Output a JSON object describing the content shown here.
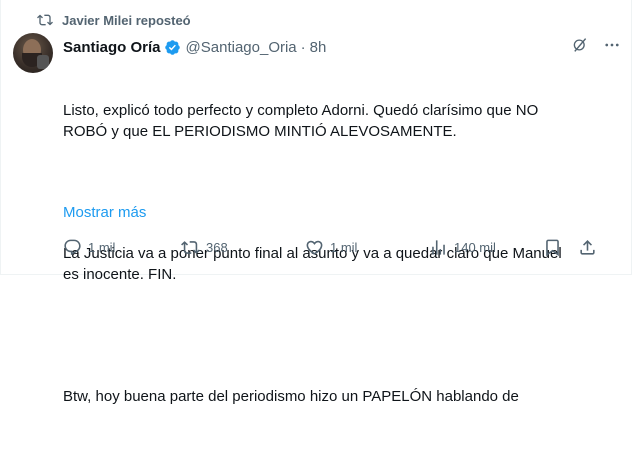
{
  "repost": {
    "text": "Javier Milei reposteó",
    "icon": "repost-icon"
  },
  "author": {
    "name": "Santiago Oría",
    "handle": "@Santiago_Oria",
    "separator": "·",
    "time": "8h",
    "verified": true,
    "verified_color": "#1d9bf0"
  },
  "tweet": {
    "paragraph1": "Listo, explicó todo perfecto y completo Adorni. Quedó clarísimo que NO\nROBÓ y que EL PERIODISMO MINTIÓ ALEVOSAMENTE.",
    "paragraph2": "La Justicia va a poner punto final al asunto y va a quedar claro que Manuel\nes inocente. FIN.",
    "paragraph3": "Btw, hoy buena parte del periodismo hizo un PAPELÓN hablando de",
    "show_more": "Mostrar más"
  },
  "metrics": {
    "replies": "1 mil",
    "reposts": "368",
    "likes": "1 mil",
    "views": "140 mil"
  },
  "colors": {
    "text": "#0f1419",
    "secondary": "#536471",
    "accent": "#1d9bf0"
  }
}
